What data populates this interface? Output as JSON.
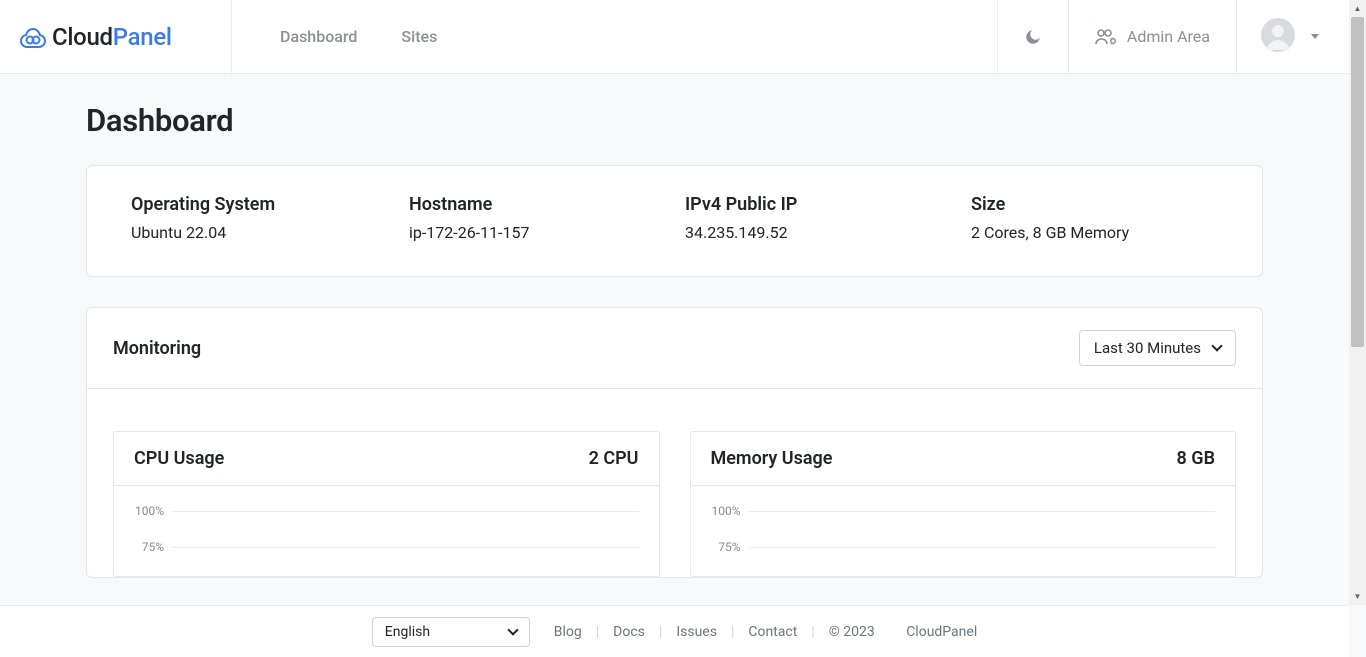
{
  "brand": {
    "cloud": "Cloud",
    "panel": "Panel"
  },
  "nav": {
    "dashboard": "Dashboard",
    "sites": "Sites"
  },
  "tools": {
    "admin_area": "Admin Area"
  },
  "page": {
    "title": "Dashboard"
  },
  "info": {
    "os_label": "Operating System",
    "os_value": "Ubuntu 22.04",
    "hostname_label": "Hostname",
    "hostname_value": "ip-172-26-11-157",
    "ip_label": "IPv4 Public IP",
    "ip_value": "34.235.149.52",
    "size_label": "Size",
    "size_value": "2 Cores, 8 GB Memory"
  },
  "monitoring": {
    "title": "Monitoring",
    "range": "Last 30 Minutes",
    "cpu_title": "CPU Usage",
    "cpu_meta": "2 CPU",
    "mem_title": "Memory Usage",
    "mem_meta": "8 GB"
  },
  "footer": {
    "language": "English",
    "blog": "Blog",
    "docs": "Docs",
    "issues": "Issues",
    "contact": "Contact",
    "copyright": "© 2023",
    "product": "CloudPanel"
  },
  "chart_data": [
    {
      "type": "line",
      "title": "CPU Usage",
      "ylabel": "percent",
      "ylim": [
        0,
        100
      ],
      "y_ticks": [
        "100%",
        "75%"
      ],
      "meta": "2 CPU",
      "series": [
        {
          "name": "CPU",
          "values": []
        }
      ]
    },
    {
      "type": "line",
      "title": "Memory Usage",
      "ylabel": "percent",
      "ylim": [
        0,
        100
      ],
      "y_ticks": [
        "100%",
        "75%"
      ],
      "meta": "8 GB",
      "series": [
        {
          "name": "Memory",
          "values": []
        }
      ]
    }
  ]
}
